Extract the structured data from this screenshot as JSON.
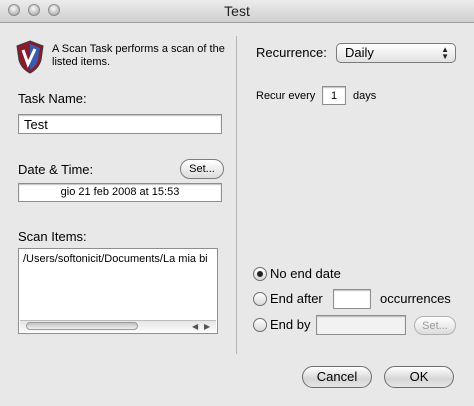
{
  "window": {
    "title": "Test"
  },
  "info": {
    "text": "A Scan Task performs a scan of the listed items."
  },
  "task_name": {
    "label": "Task Name:",
    "value": "Test"
  },
  "date_time": {
    "label": "Date & Time:",
    "value": "gio 21 feb 2008 at 15:53",
    "set_button": "Set..."
  },
  "scan_items": {
    "label": "Scan Items:",
    "items": [
      "/Users/softonicit/Documents/La mia bi"
    ]
  },
  "recurrence": {
    "label": "Recurrence:",
    "selected": "Daily",
    "recur_every_prefix": "Recur every",
    "recur_every_value": "1",
    "recur_every_suffix": "days"
  },
  "end": {
    "no_end_date": "No end date",
    "end_after": "End after",
    "end_after_value": "",
    "occurrences": "occurrences",
    "end_by": "End by",
    "end_by_value": "",
    "end_by_set": "Set...",
    "selected": "no_end_date"
  },
  "buttons": {
    "cancel": "Cancel",
    "ok": "OK"
  },
  "colors": {
    "window_bg": "#e8e8e8",
    "title_gradient_top": "#ececec",
    "title_gradient_bottom": "#cfcfcf"
  }
}
